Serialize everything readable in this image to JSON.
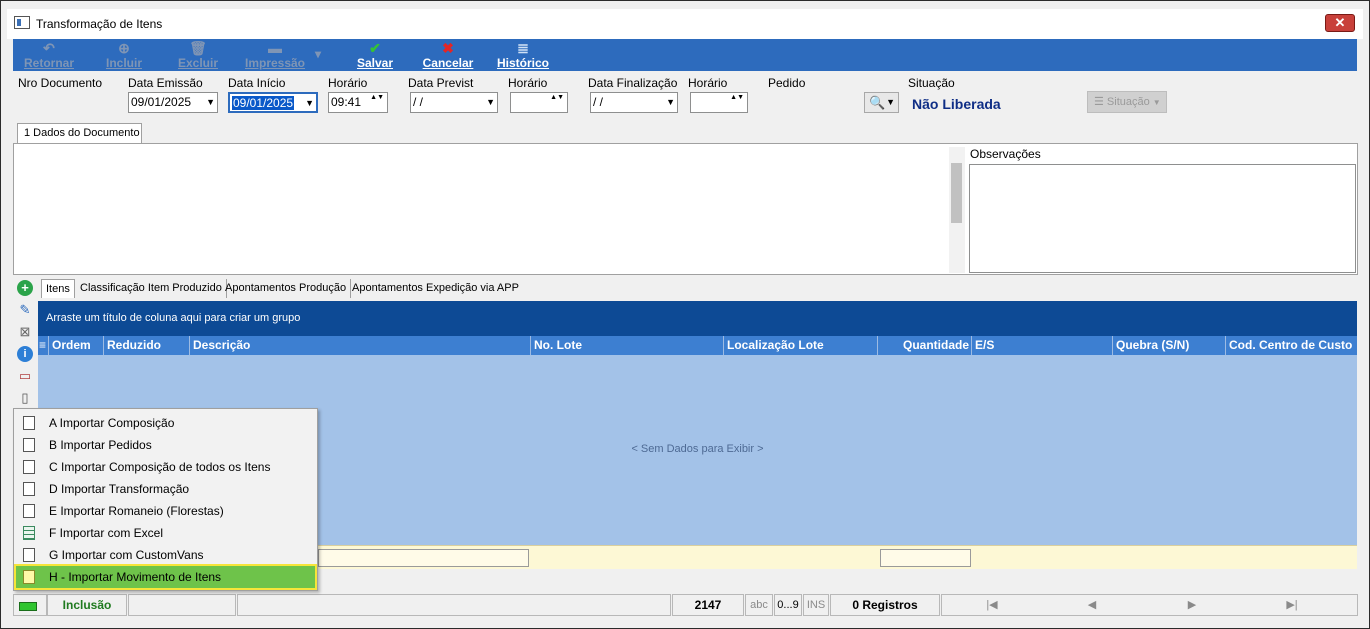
{
  "window": {
    "title": "Transformação de Itens",
    "close_label": "✕"
  },
  "toolbar": {
    "buttons": [
      {
        "label": "Retornar",
        "icon": "undo-icon",
        "glyph": "↶"
      },
      {
        "label": "Incluir",
        "icon": "add-icon",
        "glyph": "⊕"
      },
      {
        "label": "Excluir",
        "icon": "trash-icon",
        "glyph": "🗑"
      },
      {
        "label": "Impressão",
        "icon": "printer-icon",
        "glyph": "▬"
      },
      {
        "label": "Salvar",
        "icon": "check-icon",
        "glyph": "✔"
      },
      {
        "label": "Cancelar",
        "icon": "x-icon",
        "glyph": "✖"
      },
      {
        "label": "Histórico",
        "icon": "history-icon",
        "glyph": "≣"
      }
    ],
    "dropdown_glyph": "▾"
  },
  "header": {
    "nro_documento_label": "Nro Documento",
    "data_emissao_label": "Data Emissão",
    "data_emissao_value": "09/01/2025",
    "data_inicio_label": "Data Início",
    "data_inicio_value": "09/01/2025",
    "horario1_label": "Horário",
    "horario1_value": "09:41",
    "data_previst_label": "Data Previst",
    "data_previst_value": " / /",
    "horario2_label": "Horário",
    "horario2_value": "",
    "data_finalizacao_label": "Data Finalização",
    "data_finalizacao_value": " / /",
    "horario3_label": "Horário",
    "horario3_value": "",
    "pedido_label": "Pedido",
    "situacao_label": "Situação",
    "situacao_value": "Não Liberada",
    "situacao_button": "Situação",
    "search_glyph": "🔍",
    "dropdown_glyph": "▼",
    "spin_glyph": "▲▼"
  },
  "doc_tab": {
    "label": "1 Dados do Documento"
  },
  "observacoes": {
    "label": "Observações"
  },
  "subtabs": [
    "Itens",
    "Classificação Item Produzido",
    "Apontamentos Produção",
    "Apontamentos Expedição via APP"
  ],
  "grid": {
    "group_hint": "Arraste um título de coluna aqui para criar um grupo",
    "columns": [
      "Ordem",
      "Reduzido",
      "Descrição",
      "No. Lote",
      "Localização Lote",
      "Quantidade",
      "E/S",
      "Quebra (S/N)",
      "Cod. Centro de Custo"
    ],
    "empty_text": "< Sem Dados para Exibir >"
  },
  "context_menu": {
    "items": [
      {
        "label": "A Importar Composição",
        "icon": "document-icon"
      },
      {
        "label": "B Importar Pedidos",
        "icon": "document-icon"
      },
      {
        "label": "C Importar Composição de todos os Itens",
        "icon": "document-icon"
      },
      {
        "label": "D Importar Transformação",
        "icon": "document-icon"
      },
      {
        "label": "E Importar Romaneio (Florestas)",
        "icon": "document-icon"
      },
      {
        "label": "F Importar com Excel",
        "icon": "spreadsheet-icon"
      },
      {
        "label": "G Importar com CustomVans",
        "icon": "document-icon"
      },
      {
        "label": "H - Importar Movimento de Itens",
        "icon": "document-icon"
      }
    ],
    "highlighted_index": 7
  },
  "statusbar": {
    "mode": "Inclusão",
    "code": "2147",
    "abc": "abc",
    "digits": "0...9",
    "ins": "INS",
    "registros": "0 Registros",
    "nav_first": "|◀",
    "nav_prev": "◀",
    "nav_next": "▶",
    "nav_last": "▶|"
  },
  "colors": {
    "toolbar": "#2d6bbd",
    "group_bar": "#0d4a95",
    "grid_header": "#3d7fd1",
    "grid_body": "#a3c2e8",
    "highlight": "#6ec34a"
  }
}
